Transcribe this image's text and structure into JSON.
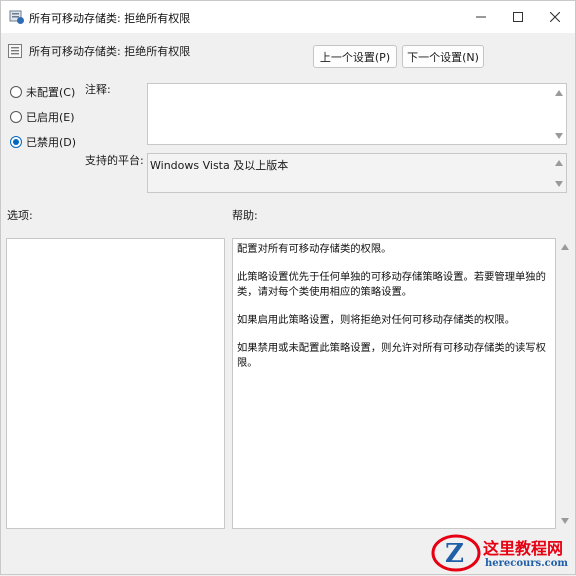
{
  "window": {
    "title": "所有可移动存储类: 拒绝所有权限",
    "controls": {
      "minimize_icon": "minimize-icon",
      "maximize_icon": "maximize-icon",
      "close_icon": "close-icon"
    }
  },
  "header": {
    "policy_title": "所有可移动存储类: 拒绝所有权限",
    "prev_button": "上一个设置(P)",
    "next_button": "下一个设置(N)"
  },
  "state": {
    "options": [
      {
        "label": "未配置(C)",
        "checked": false
      },
      {
        "label": "已启用(E)",
        "checked": false
      },
      {
        "label": "已禁用(D)",
        "checked": true
      }
    ]
  },
  "comment": {
    "label": "注释:",
    "value": ""
  },
  "platform": {
    "label": "支持的平台:",
    "value": "Windows Vista 及以上版本"
  },
  "options_section": {
    "label": "选项:"
  },
  "help_section": {
    "label": "帮助:",
    "paragraphs": [
      "配置对所有可移动存储类的权限。",
      "此策略设置优先于任何单独的可移动存储策略设置。若要管理单独的类，请对每个类使用相应的策略设置。",
      "如果启用此策略设置，则将拒绝对任何可移动存储类的权限。",
      "如果禁用或未配置此策略设置，则允许对所有可移动存储类的读写权限。"
    ]
  },
  "watermark": {
    "text": "这里教程网",
    "url": "herecours.com"
  },
  "colors": {
    "accent": "#0067c0",
    "watermark_red": "#e60012",
    "watermark_blue": "#1f5fa8"
  }
}
